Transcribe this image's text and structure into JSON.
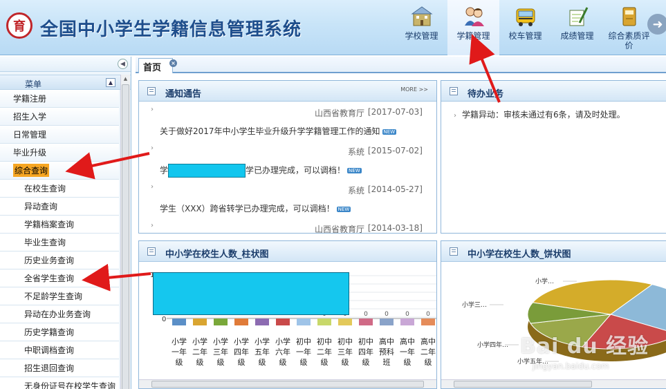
{
  "header": {
    "logo_text": "育",
    "title": "全国中小学生学籍信息管理系统",
    "nav": [
      {
        "label": "学校管理",
        "icon": "school-building-icon",
        "active": false
      },
      {
        "label": "学籍管理",
        "icon": "students-icon",
        "active": true
      },
      {
        "label": "校车管理",
        "icon": "school-bus-icon",
        "active": false
      },
      {
        "label": "成绩管理",
        "icon": "grade-notebook-icon",
        "active": false
      },
      {
        "label": "综合素质评价",
        "icon": "evaluation-book-icon",
        "active": false
      }
    ]
  },
  "sidebar": {
    "menu_title": "菜单",
    "items": [
      {
        "label": "学籍注册",
        "level": "top"
      },
      {
        "label": "招生入学",
        "level": "top"
      },
      {
        "label": "日常管理",
        "level": "top"
      },
      {
        "label": "毕业升级",
        "level": "top"
      },
      {
        "label": "综合查询",
        "level": "top",
        "highlight": true
      },
      {
        "label": "在校生查询",
        "level": "sub"
      },
      {
        "label": "异动查询",
        "level": "sub"
      },
      {
        "label": "学籍档案查询",
        "level": "sub"
      },
      {
        "label": "毕业生查询",
        "level": "sub"
      },
      {
        "label": "历史业务查询",
        "level": "sub"
      },
      {
        "label": "全省学生查询",
        "level": "sub"
      },
      {
        "label": "不足龄学生查询",
        "level": "sub"
      },
      {
        "label": "异动在办业务查询",
        "level": "sub"
      },
      {
        "label": "历史学籍查询",
        "level": "sub"
      },
      {
        "label": "中职调档查询",
        "level": "sub"
      },
      {
        "label": "招生退回查询",
        "level": "sub"
      },
      {
        "label": "无身份证号在校学生查询",
        "level": "sub"
      }
    ]
  },
  "tabs": {
    "home_label": "首页",
    "close_glyph": "×"
  },
  "notice_panel": {
    "title": "通知通告",
    "more_label": "MORE >>",
    "items": [
      {
        "source": "山西省教育厅",
        "date": "[2017-07-03]",
        "text": "关于做好2017年中小学生毕业升级升学学籍管理工作的通知",
        "badge": "NEW"
      },
      {
        "source": "系统",
        "date": "[2015-07-02]",
        "text_prefix": "学",
        "text_suffix": "学已办理完成，可以调档！",
        "badge": "NEW"
      },
      {
        "source": "系统",
        "date": "[2014-05-27]",
        "text": "学生（XXX）跨省转学已办理完成，可以调档！",
        "badge": "NEW"
      },
      {
        "source": "山西省教育厅",
        "date": "[2014-03-18]"
      }
    ]
  },
  "todo_panel": {
    "title": "待办业务",
    "items": [
      {
        "text": "学籍异动：审核未通过有6条，请及时处理。"
      }
    ]
  },
  "bar_panel": {
    "title": "中小学在校生人数_柱状图"
  },
  "pie_panel": {
    "title": "中小学在校生人数_饼状图"
  },
  "chart_data": [
    {
      "type": "bar",
      "title": "中小学在校生人数_柱状图",
      "categories": [
        "小学一年级",
        "小学二年级",
        "小学三年级",
        "小学四年级",
        "小学五年级",
        "小学六年级",
        "初中一年级",
        "初中二年级",
        "初中三年级",
        "初中四年级",
        "高中预科班",
        "高中一年级",
        "高中二年级"
      ],
      "category_labels": [
        [
          "小学",
          "一年",
          "级"
        ],
        [
          "小学",
          "二年",
          "级"
        ],
        [
          "小学",
          "三年",
          "级"
        ],
        [
          "小学",
          "四年",
          "级"
        ],
        [
          "小学",
          "五年",
          "级"
        ],
        [
          "小学",
          "六年",
          "级"
        ],
        [
          "初中",
          "一年",
          "级"
        ],
        [
          "初中",
          "二年",
          "级"
        ],
        [
          "初中",
          "三年",
          "级"
        ],
        [
          "初中",
          "四年",
          "级"
        ],
        [
          "高中",
          "预科",
          "班"
        ],
        [
          "高中",
          "一年",
          "级"
        ],
        [
          "高中",
          "二年",
          "级"
        ]
      ],
      "values": [
        null,
        null,
        null,
        null,
        null,
        null,
        null,
        0,
        0,
        0,
        0,
        0,
        0
      ],
      "y_top_label": "100",
      "y_zero_label": "0",
      "colors": [
        "#5b8fc7",
        "#d9a531",
        "#7aa83a",
        "#e07b39",
        "#8c6bb1",
        "#c94a4a",
        "#9fc4e8",
        "#c8d86a",
        "#e3c95a",
        "#d06a86",
        "#8aa3c9",
        "#c9a7d6",
        "#e58c5a"
      ]
    },
    {
      "type": "pie",
      "title": "中小学在校生人数_饼状图",
      "labels": [
        "小学…",
        "小学三…",
        "小学四年…",
        "小学五年…"
      ],
      "colors": [
        "#d4ac2a",
        "#8db9d8",
        "#c94a4a",
        "#9aa84a",
        "#7a9c3a"
      ]
    }
  ],
  "watermark": {
    "text": "Bai du 经验",
    "url": "jingyan.baidu.com"
  }
}
